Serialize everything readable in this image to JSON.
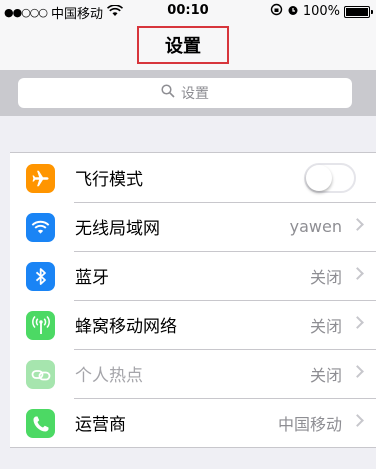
{
  "status_bar": {
    "signal_dots": "●●○○○",
    "carrier": "中国移动",
    "time": "00:10",
    "battery": "100%"
  },
  "nav": {
    "title": "设置"
  },
  "search": {
    "placeholder": "设置"
  },
  "settings": [
    {
      "label": "飞行模式",
      "value": "",
      "toggle": false,
      "icon": "airplane-icon",
      "color": "#ff9500"
    },
    {
      "label": "无线局域网",
      "value": "yawen",
      "icon": "wifi-icon",
      "color": "#1a84f5"
    },
    {
      "label": "蓝牙",
      "value": "关闭",
      "icon": "bluetooth-icon",
      "color": "#1a84f5"
    },
    {
      "label": "蜂窝移动网络",
      "value": "关闭",
      "icon": "cellular-icon",
      "color": "#4cd964"
    },
    {
      "label": "个人热点",
      "value": "关闭",
      "icon": "hotspot-icon",
      "color": "#a6e5ae"
    },
    {
      "label": "运营商",
      "value": "中国移动",
      "icon": "phone-icon",
      "color": "#4cd964"
    }
  ]
}
